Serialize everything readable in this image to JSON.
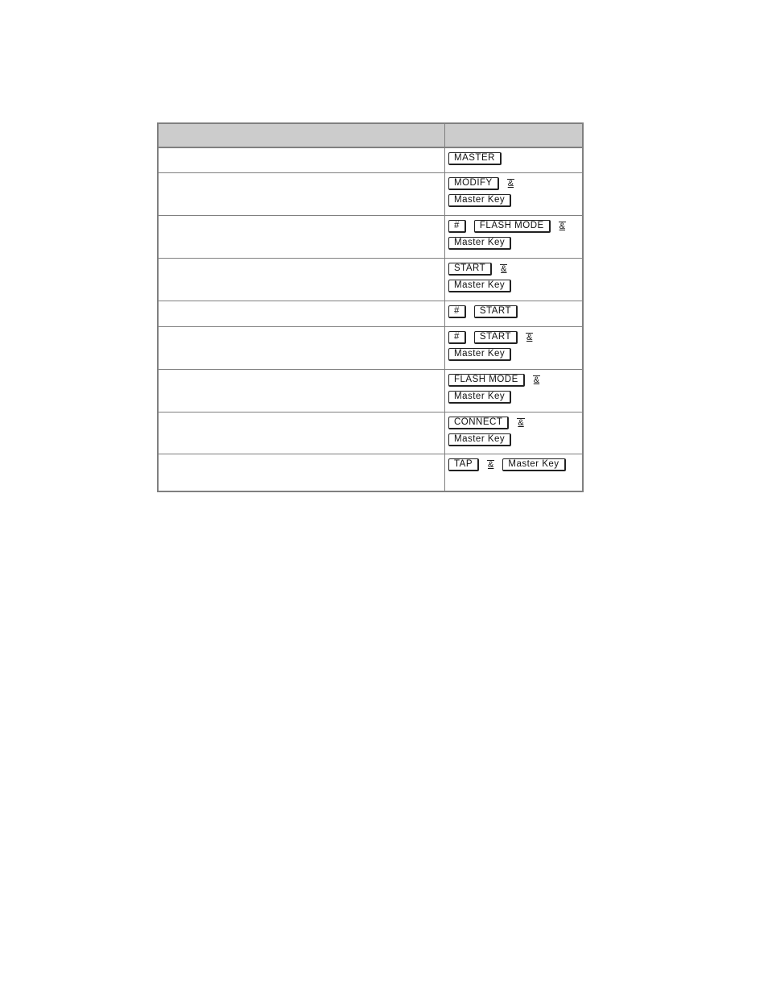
{
  "table": {
    "headers": [
      "",
      ""
    ],
    "rows": [
      {
        "description": "",
        "lines": [
          [
            {
              "type": "key",
              "text": "MASTER"
            }
          ]
        ]
      },
      {
        "description": "",
        "lines": [
          [
            {
              "type": "key",
              "text": "MODIFY"
            },
            {
              "type": "amp",
              "text": "&"
            }
          ],
          [
            {
              "type": "key",
              "text": "Master Key"
            }
          ]
        ]
      },
      {
        "description": "",
        "lines": [
          [
            {
              "type": "key",
              "text": "#"
            },
            {
              "type": "key",
              "text": "FLASH MODE"
            },
            {
              "type": "amp",
              "text": "&"
            }
          ],
          [
            {
              "type": "key",
              "text": "Master Key"
            }
          ]
        ]
      },
      {
        "description": "",
        "lines": [
          [
            {
              "type": "key",
              "text": "START"
            },
            {
              "type": "amp",
              "text": "&"
            }
          ],
          [
            {
              "type": "key",
              "text": "Master Key"
            }
          ]
        ]
      },
      {
        "description": "",
        "lines": [
          [
            {
              "type": "key",
              "text": "#"
            },
            {
              "type": "key",
              "text": "START"
            }
          ]
        ]
      },
      {
        "description": "",
        "lines": [
          [
            {
              "type": "key",
              "text": "#"
            },
            {
              "type": "key",
              "text": "START"
            },
            {
              "type": "amp",
              "text": "&"
            }
          ],
          [
            {
              "type": "key",
              "text": "Master Key"
            }
          ]
        ]
      },
      {
        "description": "",
        "lines": [
          [
            {
              "type": "key",
              "text": "FLASH MODE"
            },
            {
              "type": "amp",
              "text": "&"
            }
          ],
          [
            {
              "type": "key",
              "text": "Master Key"
            }
          ]
        ]
      },
      {
        "description": "",
        "lines": [
          [
            {
              "type": "key",
              "text": "CONNECT"
            },
            {
              "type": "amp",
              "text": "&"
            }
          ],
          [
            {
              "type": "key",
              "text": "Master Key"
            }
          ]
        ]
      },
      {
        "description": "",
        "lines": [
          [
            {
              "type": "key",
              "text": "TAP"
            },
            {
              "type": "amp",
              "text": "&"
            },
            {
              "type": "key",
              "text": "Master Key"
            }
          ]
        ]
      }
    ]
  }
}
